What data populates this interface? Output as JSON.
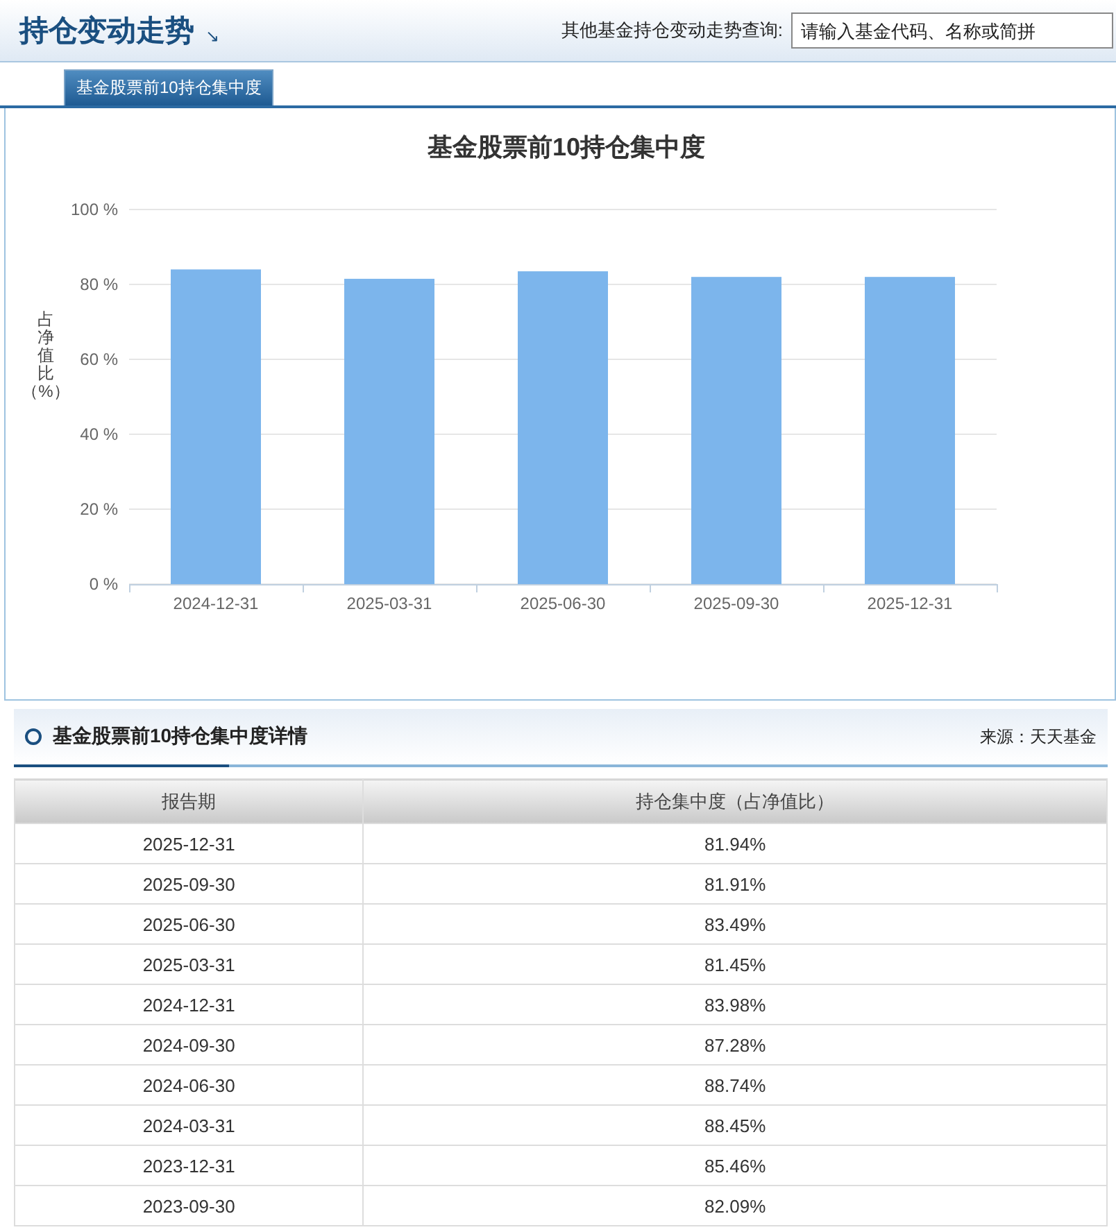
{
  "header": {
    "title": "持仓变动走势",
    "arrow": "↘",
    "search_label": "其他基金持仓变动走势查询:",
    "search": {
      "placeholder": "请输入基金代码、名称或简拼"
    }
  },
  "tabs": [
    {
      "label": "基金股票前10持仓集中度",
      "selected": true
    }
  ],
  "chart": {
    "chart_data": {
      "type": "bar",
      "title": "基金股票前10持仓集中度",
      "ylabel": "占净值比（%）",
      "categories": [
        "2024-12-31",
        "2025-03-31",
        "2025-06-30",
        "2025-09-30",
        "2025-12-31"
      ],
      "series": [
        {
          "color": "#7cb5ec",
          "values": [
            84,
            81.5,
            83.5,
            82,
            82
          ]
        }
      ],
      "grid": true,
      "ylim": [
        0,
        100
      ],
      "yticks": [
        {
          "value": 0,
          "label": "0 %"
        },
        {
          "value": 20,
          "label": "20 %"
        },
        {
          "value": 40,
          "label": "40 %"
        },
        {
          "value": 60,
          "label": "60 %"
        },
        {
          "value": 80,
          "label": "80 %"
        },
        {
          "value": 100,
          "label": "100 %"
        }
      ]
    }
  },
  "details": {
    "title": "基金股票前10持仓集中度详情",
    "source": "来源：天天基金",
    "table": {
      "columns": [
        "报告期",
        "持仓集中度（占净值比）"
      ],
      "rows": [
        [
          "2025-12-31",
          "81.94%"
        ],
        [
          "2025-09-30",
          "81.91%"
        ],
        [
          "2025-06-30",
          "83.49%"
        ],
        [
          "2025-03-31",
          "81.45%"
        ],
        [
          "2024-12-31",
          "83.98%"
        ],
        [
          "2024-09-30",
          "87.28%"
        ],
        [
          "2024-06-30",
          "88.74%"
        ],
        [
          "2024-03-31",
          "88.45%"
        ],
        [
          "2023-12-31",
          "85.46%"
        ],
        [
          "2023-09-30",
          "82.09%"
        ]
      ]
    }
  }
}
